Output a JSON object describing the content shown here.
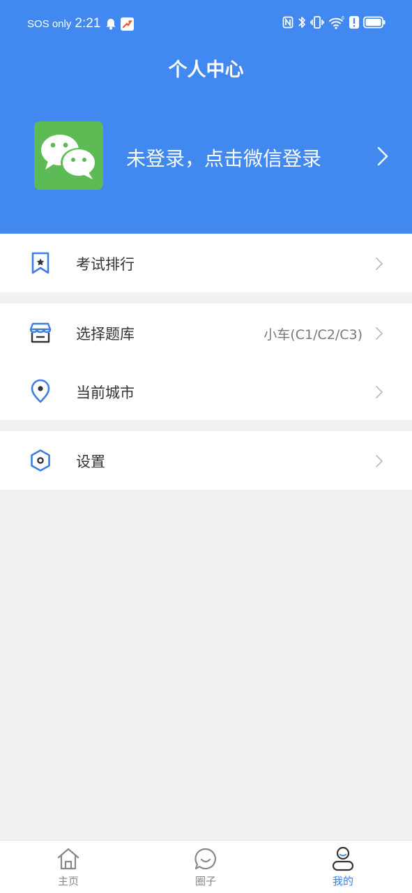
{
  "status_bar": {
    "carrier": "SOS only",
    "time": "2:21",
    "icons": [
      "bell-icon",
      "app-notification-icon",
      "nfc-icon",
      "bluetooth-icon",
      "vibrate-icon",
      "wifi-icon",
      "alert-icon",
      "battery-icon"
    ]
  },
  "header": {
    "title": "个人中心",
    "background_color": "#4189f1"
  },
  "login": {
    "text": "未登录，点击微信登录",
    "logo_icon": "wechat-icon",
    "logo_color": "#5cbb55"
  },
  "menu": {
    "exam_ranking": {
      "label": "考试排行",
      "icon": "bookmark-star-icon"
    },
    "question_bank": {
      "label": "选择题库",
      "value": "小车(C1/C2/C3)",
      "icon": "store-icon"
    },
    "current_city": {
      "label": "当前城市",
      "icon": "location-pin-icon"
    },
    "settings": {
      "label": "设置",
      "icon": "hexagon-settings-icon"
    }
  },
  "tab_bar": {
    "home": {
      "label": "主页",
      "icon": "home-icon"
    },
    "circle": {
      "label": "圈子",
      "icon": "chat-bubble-icon"
    },
    "mine": {
      "label": "我的",
      "icon": "user-icon",
      "active": true
    },
    "active_color": "#3b7fe0"
  }
}
